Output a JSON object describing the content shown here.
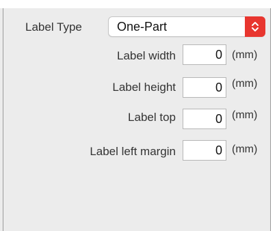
{
  "label_type": {
    "label": "Label Type",
    "selected": "One-Part"
  },
  "fields": [
    {
      "label": "Label width",
      "value": "0",
      "unit": "(mm)"
    },
    {
      "label": "Label height",
      "value": "0",
      "unit": "(mm)"
    },
    {
      "label": "Label top",
      "value": "0",
      "unit": "(mm)"
    },
    {
      "label": "Label left margin",
      "value": "0",
      "unit": "(mm)"
    }
  ],
  "colors": {
    "stepper_accent": "#e8362f",
    "panel_background": "#ececec"
  },
  "icons": {
    "select_stepper": "up-down-chevron-icon"
  }
}
